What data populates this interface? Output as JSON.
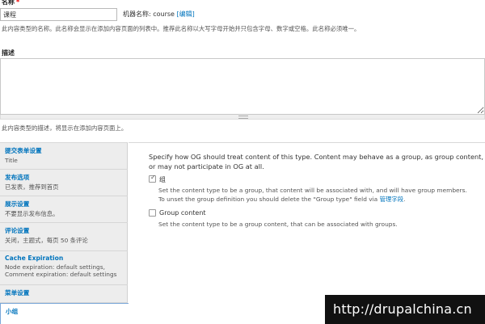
{
  "name_field": {
    "label": "名称",
    "required_mark": "*",
    "value": "课程",
    "machine_name_prefix": "机器名称: course",
    "edit_link": "[编辑]",
    "help": "此内容类型的名称。此名称会显示在添加内容页面的列表中。推荐此名称以大写字母开始并只包含字母、数字或空格。此名称必须唯一。"
  },
  "description_field": {
    "label": "描述",
    "value": "",
    "help": "此内容类型的描述，将显示在添加内容页面上。"
  },
  "vertical_tabs": [
    {
      "title": "提交表单设置",
      "summary": "Title"
    },
    {
      "title": "发布选项",
      "summary": "已发表，推荐到首页"
    },
    {
      "title": "展示设置",
      "summary": "不要显示发布信息。"
    },
    {
      "title": "评论设置",
      "summary": "关闭，主题式，每页 50 条评论"
    },
    {
      "title": "Cache Expiration",
      "summary": "Node expiration: default settings,\nComment expiration: default settings"
    },
    {
      "title": "菜单设置",
      "summary": ""
    },
    {
      "title": "小组",
      "summary": ""
    }
  ],
  "og_panel": {
    "intro": "Specify how OG should treat content of this type. Content may behave as a group, as group content, or may not participate in OG at all.",
    "group": {
      "label": "组",
      "checked": true,
      "desc_line1": "Set the content type to be a group, that content will be associated with, and will have group members.",
      "desc_line2": "To unset the group definition you should delete the \"Group type\" field via",
      "desc_link": "管理字段",
      "desc_end": "."
    },
    "group_content": {
      "label": "Group content",
      "checked": false,
      "desc": "Set the content type to be a group content, that can be associated with groups."
    }
  },
  "watermark": "http://drupalchina.cn"
}
